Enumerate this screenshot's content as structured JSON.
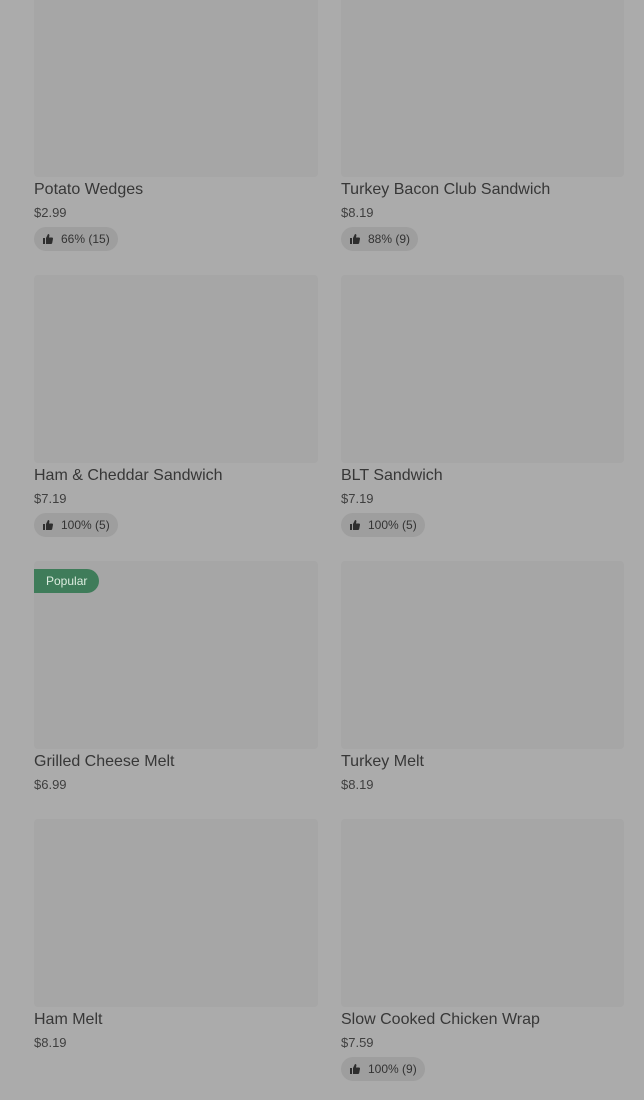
{
  "items": [
    {
      "name": "Potato Wedges",
      "price": "$2.99",
      "rating": "66% (15)"
    },
    {
      "name": "Turkey Bacon Club Sandwich",
      "price": "$8.19",
      "rating": "88% (9)"
    },
    {
      "name": "Ham & Cheddar Sandwich",
      "price": "$7.19",
      "rating": "100% (5)"
    },
    {
      "name": "BLT Sandwich",
      "price": "$7.19",
      "rating": "100% (5)"
    },
    {
      "name": "Grilled Cheese Melt",
      "price": "$6.99",
      "badge": "Popular"
    },
    {
      "name": "Turkey Melt",
      "price": "$8.19"
    },
    {
      "name": "Ham Melt",
      "price": "$8.19"
    },
    {
      "name": "Slow Cooked Chicken Wrap",
      "price": "$7.59",
      "rating": "100% (9)"
    }
  ]
}
